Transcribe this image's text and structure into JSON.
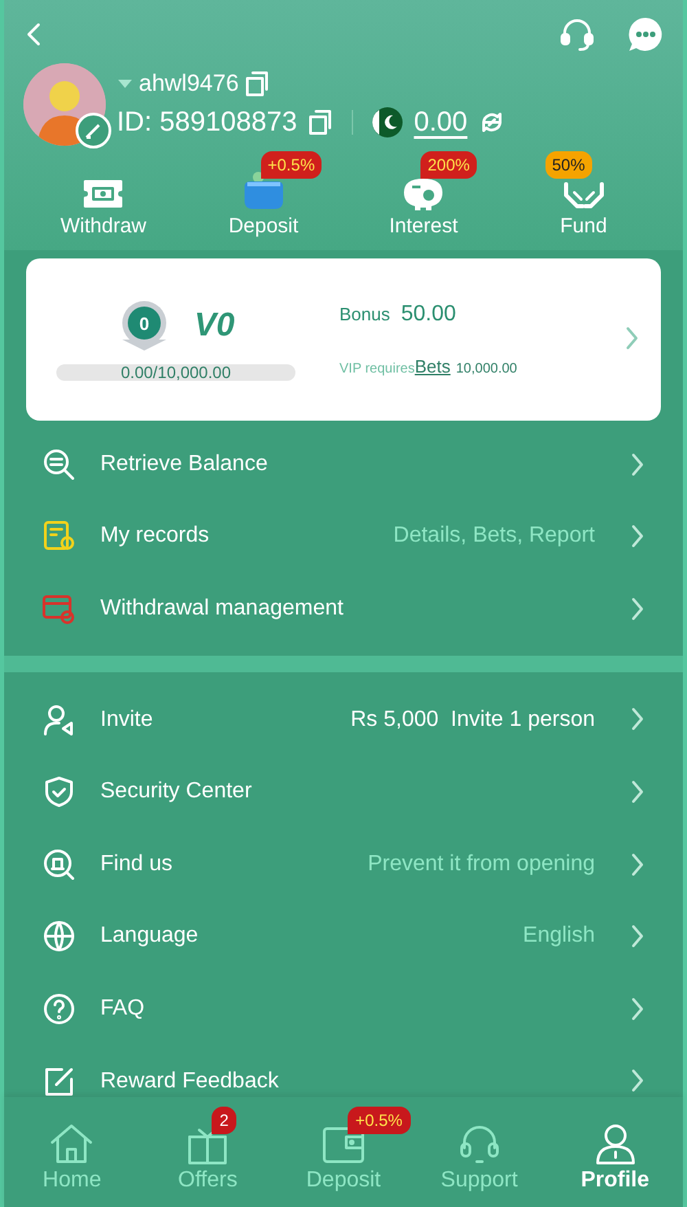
{
  "profile": {
    "username": "ahwl9476",
    "id_label": "ID:",
    "id": "589108873",
    "balance": "0.00"
  },
  "quick_actions": [
    {
      "kind": "withdraw",
      "label": "Withdraw"
    },
    {
      "kind": "deposit",
      "label": "Deposit",
      "badge": {
        "text": "+0.5%",
        "color": "#d0201c"
      }
    },
    {
      "kind": "interest",
      "label": "Interest",
      "badge": {
        "text": "200%",
        "color": "#d0201c"
      }
    },
    {
      "kind": "fund",
      "label": "Fund",
      "badge": {
        "text": "50%",
        "color": "#f5a300"
      }
    }
  ],
  "vip": {
    "medal": "0",
    "level_name": "V0",
    "progress_text": "0.00/10,000.00",
    "level": 0,
    "bonus_label": "Bonus",
    "bonus": "50.00",
    "requirement_label": "VIP requires",
    "requirement_link": "Bets",
    "requirement_value": "10,000.00"
  },
  "menu_groups": [
    [
      {
        "kind": "retrieve",
        "label": "Retrieve Balance"
      },
      {
        "kind": "records",
        "label": "My records",
        "value": "Details, Bets, Report",
        "highlighted": false
      },
      {
        "kind": "withdrawal",
        "label": "Withdrawal management"
      }
    ],
    [
      {
        "kind": "invite",
        "label": "Invite",
        "value": "Rs 5,000  Invite 1 person",
        "highlighted": true
      },
      {
        "kind": "security",
        "label": "Security Center"
      },
      {
        "kind": "find",
        "label": "Find us",
        "value": "Prevent it from opening",
        "highlighted": false
      },
      {
        "kind": "language",
        "label": "Language",
        "value": "English",
        "highlighted": false
      },
      {
        "kind": "faq",
        "label": "FAQ"
      },
      {
        "kind": "feedback",
        "label": "Reward Feedback"
      }
    ]
  ],
  "bottom_nav": [
    {
      "kind": "home",
      "label": "Home",
      "selected": false
    },
    {
      "kind": "offers",
      "label": "Offers",
      "selected": false,
      "badge": "2"
    },
    {
      "kind": "deposit",
      "label": "Deposit",
      "selected": false,
      "badge": "+0.5%"
    },
    {
      "kind": "support",
      "label": "Support",
      "selected": false
    },
    {
      "kind": "profile",
      "label": "Profile",
      "selected": true
    }
  ]
}
